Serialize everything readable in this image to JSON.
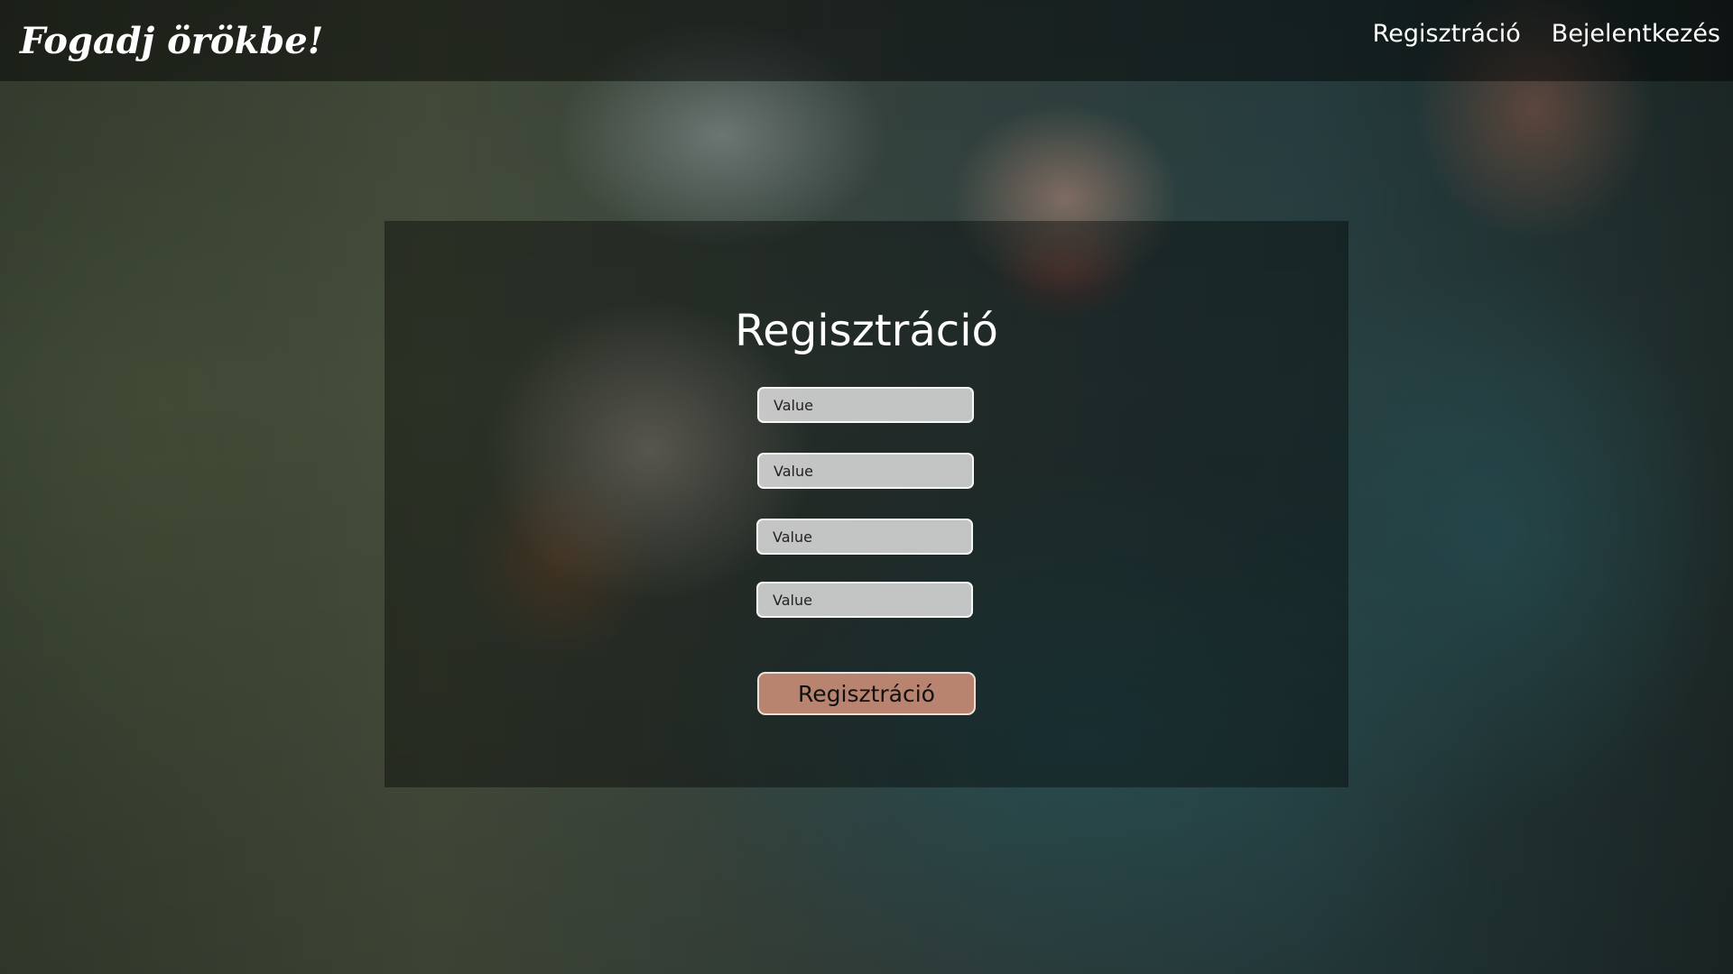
{
  "header": {
    "logo_text": "Fogadj örökbe!",
    "nav": [
      {
        "label": "Regisztráció"
      },
      {
        "label": "Bejelentkezés"
      }
    ]
  },
  "form": {
    "title": "Regisztráció",
    "fields": [
      {
        "placeholder": "Value"
      },
      {
        "placeholder": "Value"
      },
      {
        "placeholder": "Value"
      },
      {
        "placeholder": "Value"
      }
    ],
    "submit_label": "Regisztráció"
  },
  "colors": {
    "button": "#b9846f",
    "text": "#ffffff"
  }
}
